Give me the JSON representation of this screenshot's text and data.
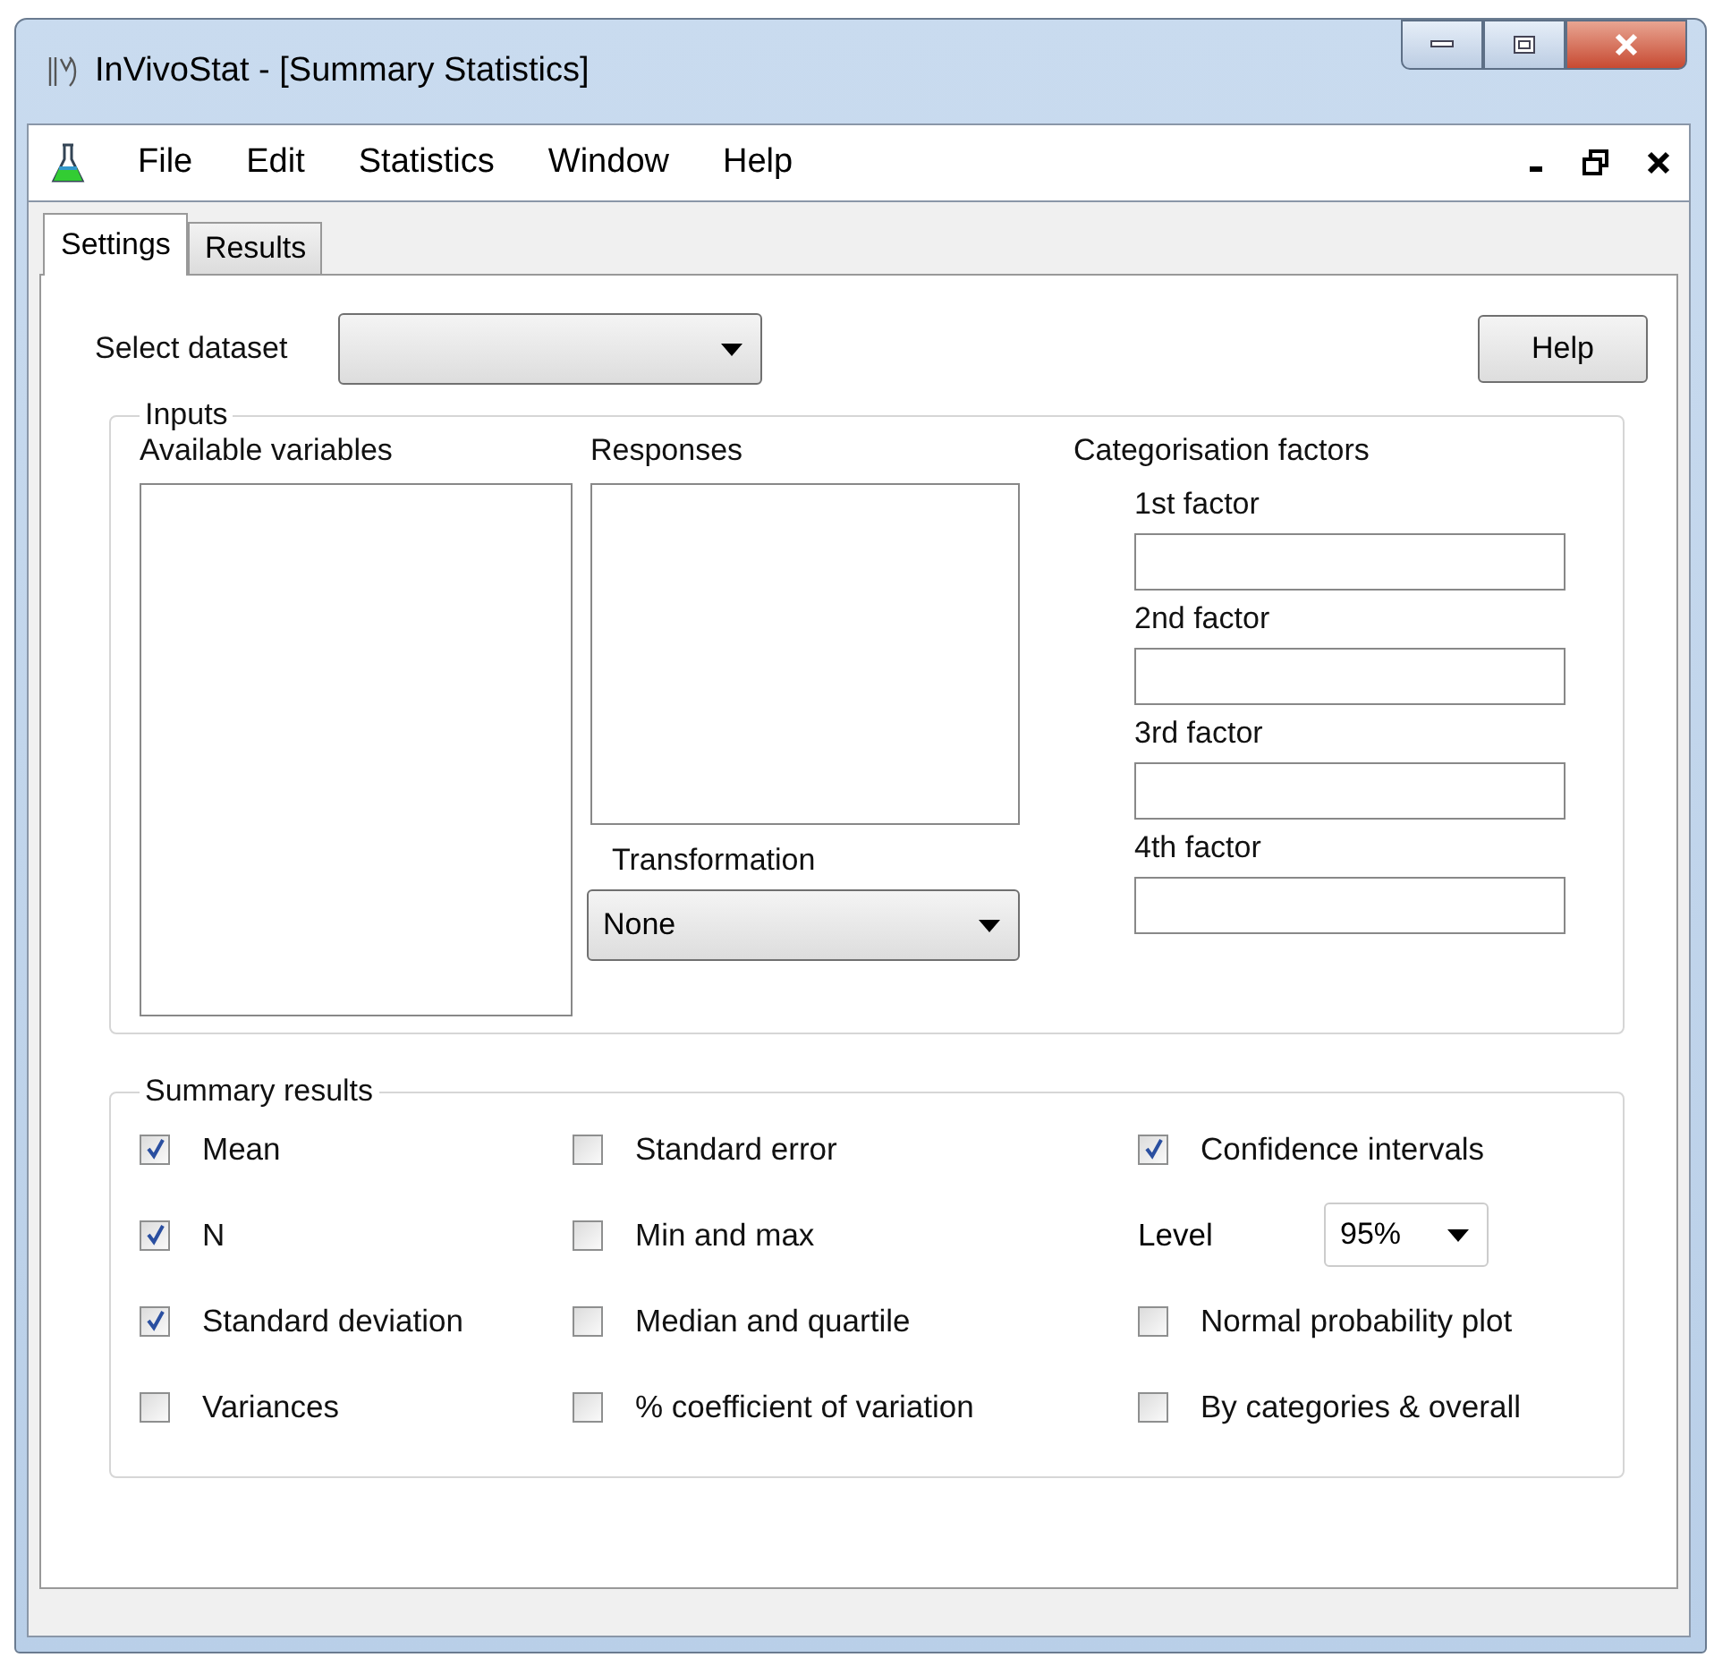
{
  "window": {
    "title": "InVivoStat - [Summary Statistics]"
  },
  "menu": [
    "File",
    "Edit",
    "Statistics",
    "Window",
    "Help"
  ],
  "tabs": [
    {
      "label": "Settings",
      "selected": true
    },
    {
      "label": "Results",
      "selected": false
    }
  ],
  "dataset": {
    "label": "Select dataset"
  },
  "help_button": "Help",
  "inputs": {
    "title": "Inputs",
    "available_label": "Available variables",
    "responses_label": "Responses",
    "transformation_label": "Transformation",
    "transformation_value": "None",
    "factors_label": "Categorisation factors",
    "factors": [
      "1st factor",
      "2nd factor",
      "3rd factor",
      "4th factor"
    ]
  },
  "summary": {
    "title": "Summary results",
    "columns": [
      [
        {
          "kind": "checkbox",
          "label": "Mean",
          "checked": true
        },
        {
          "kind": "checkbox",
          "label": "N",
          "checked": true
        },
        {
          "kind": "checkbox",
          "label": "Standard deviation",
          "checked": true
        },
        {
          "kind": "checkbox",
          "label": "Variances",
          "checked": false
        }
      ],
      [
        {
          "kind": "checkbox",
          "label": "Standard error",
          "checked": false
        },
        {
          "kind": "checkbox",
          "label": "Min and max",
          "checked": false
        },
        {
          "kind": "checkbox",
          "label": "Median and quartile",
          "checked": false
        },
        {
          "kind": "checkbox",
          "label": "% coefficient of variation",
          "checked": false
        }
      ],
      [
        {
          "kind": "checkbox",
          "label": "Confidence intervals",
          "checked": true
        },
        {
          "kind": "dropdown",
          "label": "Level",
          "value": "95%"
        },
        {
          "kind": "checkbox",
          "label": "Normal probability plot",
          "checked": false
        },
        {
          "kind": "checkbox",
          "label": "By categories & overall",
          "checked": false
        }
      ]
    ]
  }
}
